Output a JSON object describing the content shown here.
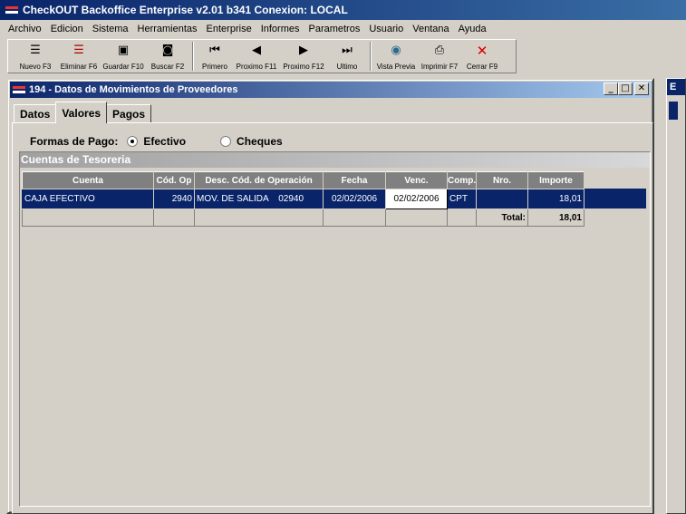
{
  "app": {
    "title": "CheckOUT Backoffice Enterprise v2.01 b341 Conexion: LOCAL"
  },
  "menu": [
    "Archivo",
    "Edicion",
    "Sistema",
    "Herramientas",
    "Enterprise",
    "Informes",
    "Parametros",
    "Usuario",
    "Ventana",
    "Ayuda"
  ],
  "toolbar": {
    "nuevo": "Nuevo F3",
    "eliminar": "Eliminar F6",
    "guardar": "Guardar F10",
    "buscar": "Buscar F2",
    "primero": "Primero",
    "proximo_f11": "Proximo F11",
    "proximo_f12": "Proximo F12",
    "ultimo": "Ultimo",
    "vista_previa": "Vista Previa",
    "imprimir": "Imprimir F7",
    "cerrar": "Cerrar F9"
  },
  "background_window": {
    "title": "E"
  },
  "window": {
    "title": "194 - Datos de Movimientos de Proveedores"
  },
  "tabs": [
    {
      "label": "Datos"
    },
    {
      "label": "Valores"
    },
    {
      "label": "Pagos"
    }
  ],
  "forma_pago": {
    "label": "Formas de Pago:",
    "options": [
      {
        "label": "Efectivo",
        "checked": true
      },
      {
        "label": "Cheques",
        "checked": false
      }
    ]
  },
  "cuentas": {
    "title": "Cuentas de Tesoreria",
    "columns": [
      "Cuenta",
      "Cód. Op",
      "Desc. Cód. de Operación",
      "Fecha",
      "Venc.",
      "Comp.",
      "Nro.",
      "Importe"
    ],
    "rows": [
      {
        "cuenta": "CAJA EFECTIVO",
        "cod_op": "2940",
        "desc": "MOV. DE SALIDA    02940",
        "fecha": "02/02/2006",
        "venc": "02/02/2006",
        "comp": "CPT",
        "nro": "",
        "importe": "18,01"
      }
    ],
    "total_label": "Total:",
    "total_value": "18,01"
  }
}
